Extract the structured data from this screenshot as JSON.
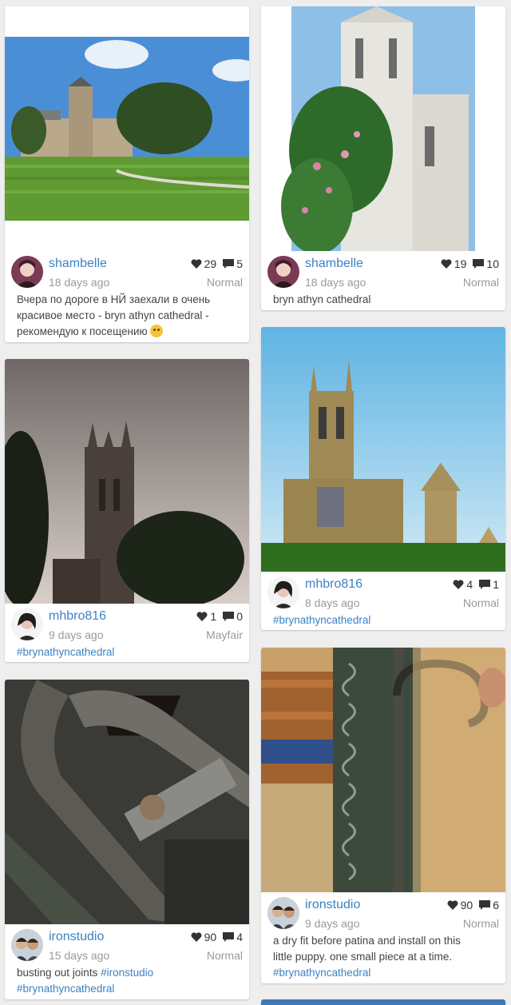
{
  "icons": {
    "like": "heart-icon",
    "comment": "comment-bubble-icon",
    "wink": "winking-face-emoji"
  },
  "colors": {
    "link": "#3b82c4",
    "muted": "#9a9a9a",
    "background": "#eeeeee"
  },
  "posts": [
    {
      "username": "shambelle",
      "age": "18 days ago",
      "likes": "29",
      "comments": "5",
      "filter": "Normal",
      "caption_text": "Вчера по дороге в НЙ заехали в очень красивое место - bryn athyn cathedral - рекомендую к посещению",
      "caption_line1": "Вчера по дороге в НЙ заехали в очень",
      "caption_line2": "красивое место - bryn athyn cathedral -",
      "caption_line3": "рекомендую к посещению"
    },
    {
      "username": "shambelle",
      "age": "18 days ago",
      "likes": "19",
      "comments": "10",
      "filter": "Normal",
      "caption_text": "bryn athyn cathedral"
    },
    {
      "username": "mhbro816",
      "age": "9 days ago",
      "likes": "1",
      "comments": "0",
      "filter": "Mayfair",
      "hashtag": "#brynathyncathedral"
    },
    {
      "username": "mhbro816",
      "age": "8 days ago",
      "likes": "4",
      "comments": "1",
      "filter": "Normal",
      "hashtag": "#brynathyncathedral"
    },
    {
      "username": "ironstudio",
      "age": "15 days ago",
      "likes": "90",
      "comments": "4",
      "filter": "Normal",
      "caption_text": "busting out joints",
      "hashtag1": "#ironstudio",
      "hashtag2": "#brynathyncathedral"
    },
    {
      "username": "ironstudio",
      "age": "9 days ago",
      "likes": "90",
      "comments": "6",
      "filter": "Normal",
      "caption_line1": "a dry fit before patina and install on this",
      "caption_line2": "little puppy. one small piece at a time.",
      "hashtag": "#brynathyncathedral"
    }
  ]
}
